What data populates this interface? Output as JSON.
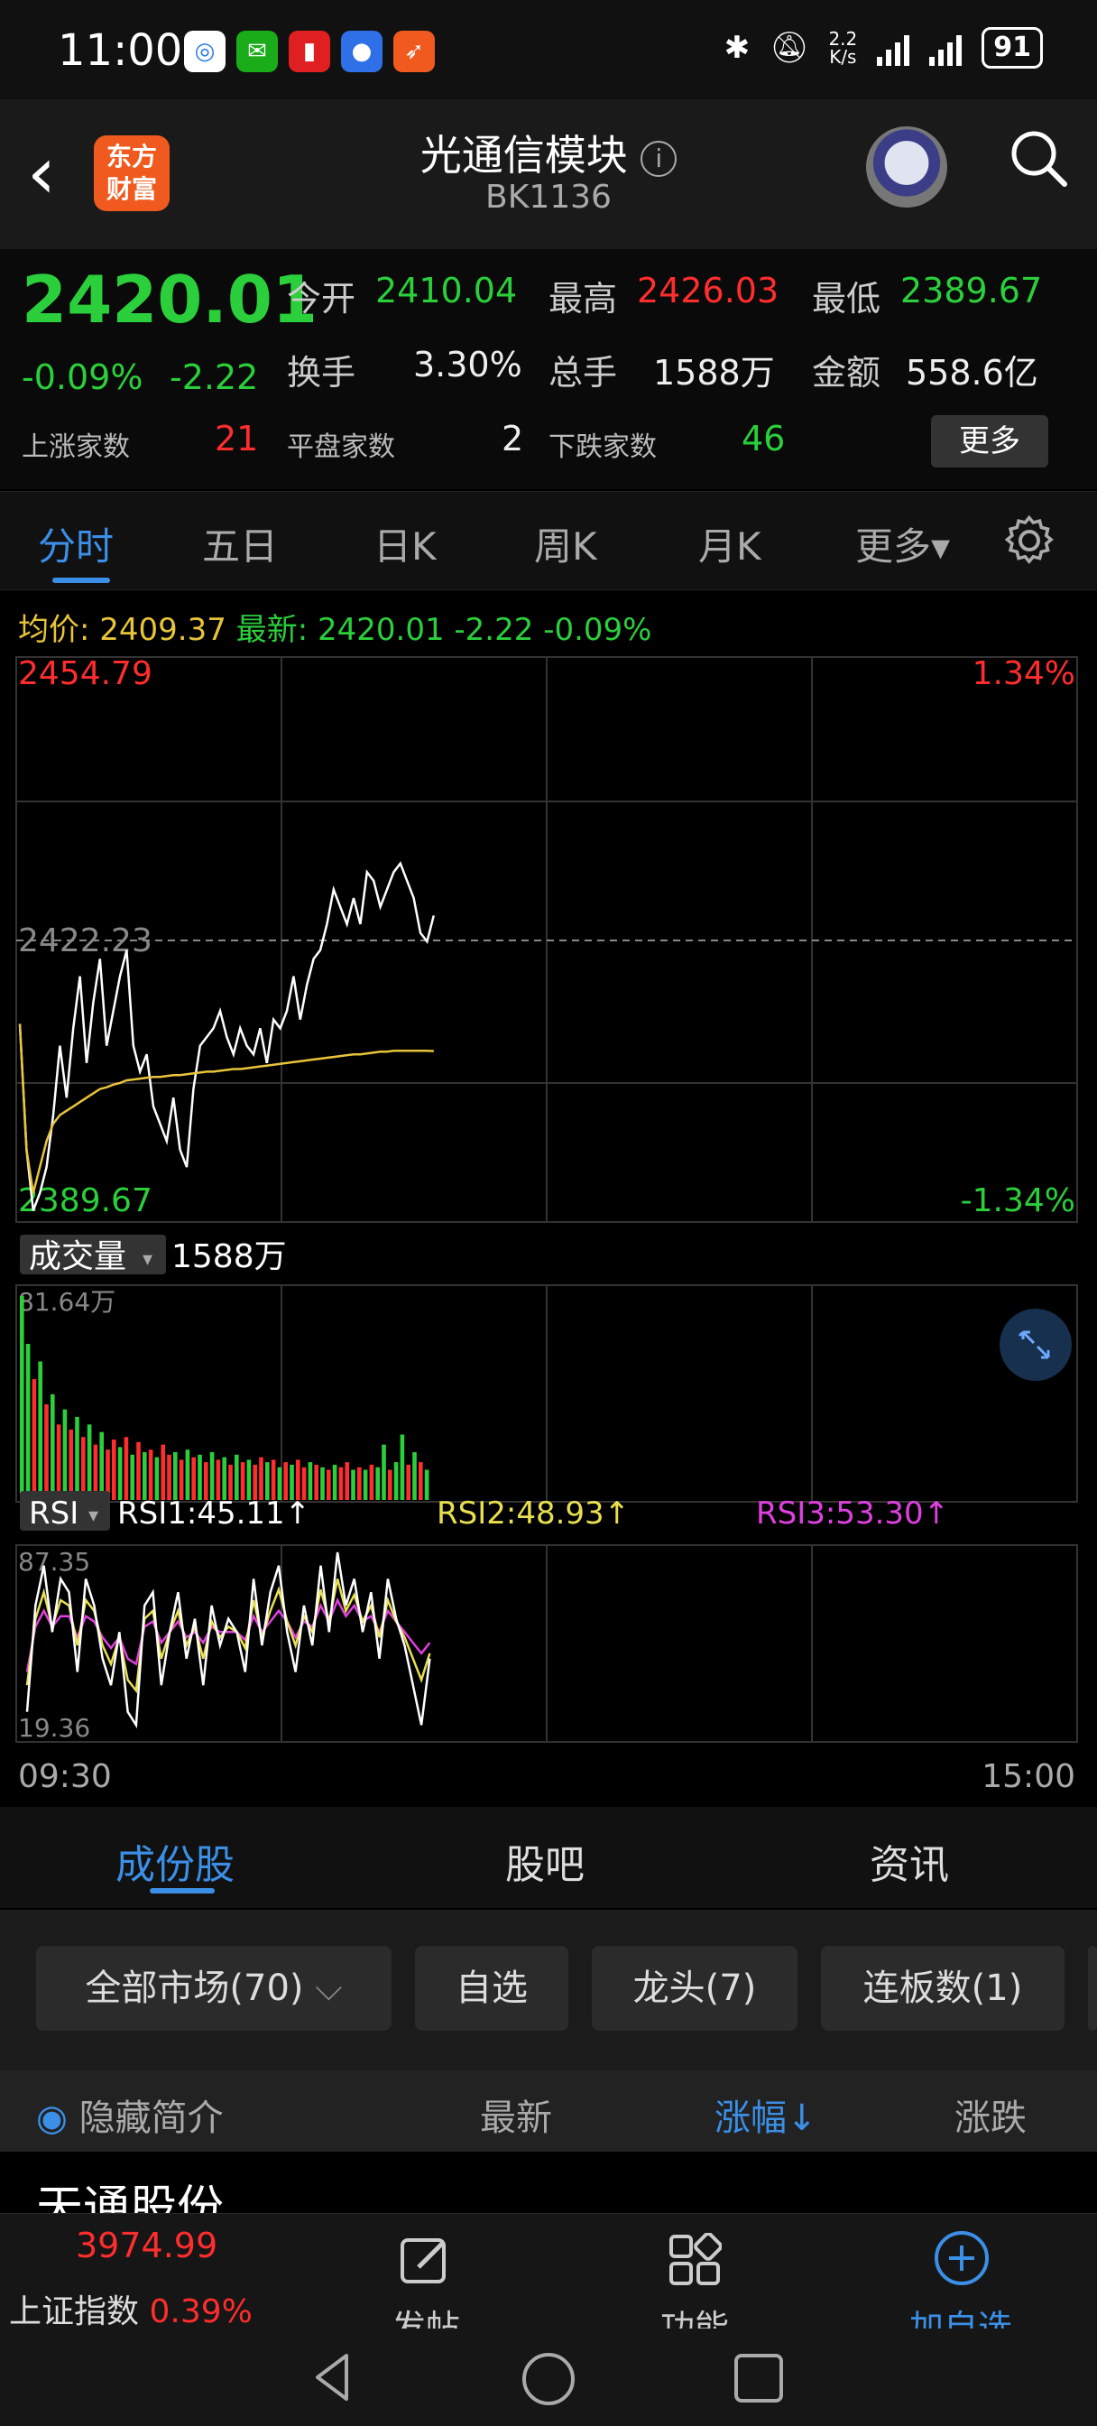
{
  "status_bar": {
    "time": "11:00",
    "net_speed_top": "2.2",
    "net_speed_unit": "K/s",
    "battery": "91"
  },
  "header": {
    "title": "光通信模块",
    "code": "BK1136",
    "logo_line1": "东方",
    "logo_line2": "财富"
  },
  "quote": {
    "price": "2420.01",
    "change_pct": "-0.09%",
    "change_val": "-2.22",
    "open_label": "今开",
    "open": "2410.04",
    "high_label": "最高",
    "high": "2426.03",
    "low_label": "最低",
    "low": "2389.67",
    "turnover_label": "换手",
    "turnover": "3.30%",
    "volume_label": "总手",
    "volume": "1588万",
    "amount_label": "金额",
    "amount": "558.6亿",
    "up_label": "上涨家数",
    "up_count": "21",
    "flat_label": "平盘家数",
    "flat_count": "2",
    "down_label": "下跌家数",
    "down_count": "46",
    "more": "更多"
  },
  "tabs": [
    "分时",
    "五日",
    "日K",
    "周K",
    "月K",
    "更多▾"
  ],
  "active_tab": "分时",
  "info_line": {
    "avg_label": "均价:",
    "avg": "2409.37",
    "latest_label": "最新:",
    "latest": "2420.01",
    "chg": "-2.22",
    "pct": "-0.09%"
  },
  "chart_data": {
    "type": "line",
    "price_axis": {
      "top": "2454.79",
      "mid": "2422.23",
      "bottom": "2389.67",
      "top_pct": "1.34%",
      "bottom_pct": "-1.34%"
    },
    "ylim": [
      2389.67,
      2454.79
    ],
    "prev_close": 2422.23,
    "x_labels": [
      "09:30",
      "15:00"
    ],
    "series": [
      {
        "values": [
          2412.5,
          2398,
          2391,
          2393,
          2396,
          2402,
          2410,
          2404,
          2412,
          2418,
          2408,
          2415,
          2420,
          2410,
          2414,
          2418,
          2421,
          2410,
          2407,
          2409,
          2403,
          2401,
          2399,
          2404,
          2398,
          2396,
          2405,
          2410,
          2411,
          2412,
          2414,
          2411,
          2409,
          2412,
          2410,
          2409,
          2412,
          2408,
          2413,
          2412,
          2414,
          2418,
          2413,
          2417,
          2420,
          2421,
          2424,
          2428,
          2426,
          2424,
          2427,
          2424,
          2430,
          2429,
          2426,
          2428,
          2430,
          2431,
          2429,
          2427,
          2423,
          2422,
          2425
        ]
      },
      {
        "values": [
          2412.5,
          2398,
          2393,
          2396,
          2399,
          2401,
          2402,
          2402.5,
          2403,
          2403.5,
          2404,
          2404.5,
          2405,
          2405.2,
          2405.5,
          2405.7,
          2406,
          2406.1,
          2406.2,
          2406.3,
          2406.4,
          2406.4,
          2406.5,
          2406.6,
          2406.6,
          2406.7,
          2406.8,
          2406.9,
          2407,
          2407,
          2407.1,
          2407.2,
          2407.3,
          2407.3,
          2407.4,
          2407.5,
          2407.6,
          2407.7,
          2407.8,
          2407.9,
          2408,
          2408.1,
          2408.2,
          2408.3,
          2408.4,
          2408.5,
          2408.6,
          2408.7,
          2408.8,
          2408.9,
          2409,
          2409,
          2409.1,
          2409.2,
          2409.3,
          2409.3,
          2409.4,
          2409.4,
          2409.4,
          2409.4,
          2409.4,
          2409.4,
          2409.37
        ]
      }
    ]
  },
  "volume_panel": {
    "label": "成交量",
    "total": "1588万",
    "max_label": "81.64万",
    "values": [
      81,
      62,
      48,
      55,
      38,
      42,
      30,
      36,
      28,
      33,
      25,
      30,
      22,
      27,
      20,
      24,
      21,
      25,
      18,
      23,
      19,
      20,
      17,
      22,
      18,
      19,
      16,
      20,
      17,
      18,
      15,
      19,
      16,
      17,
      14,
      18,
      15,
      16,
      14,
      17,
      15,
      16,
      13,
      15,
      14,
      16,
      13,
      15,
      14,
      13,
      12,
      14,
      13,
      15,
      12,
      13,
      12,
      14,
      13,
      22,
      12,
      15,
      26,
      14,
      19,
      15,
      12
    ],
    "colors": [
      "g",
      "g",
      "r",
      "g",
      "r",
      "g",
      "r",
      "g",
      "r",
      "g",
      "r",
      "g",
      "r",
      "g",
      "r",
      "r",
      "g",
      "r",
      "g",
      "r",
      "g",
      "r",
      "g",
      "r",
      "r",
      "g",
      "r",
      "g",
      "r",
      "g",
      "r",
      "g",
      "r",
      "g",
      "r",
      "g",
      "r",
      "g",
      "r",
      "r",
      "g",
      "r",
      "g",
      "r",
      "g",
      "r",
      "r",
      "g",
      "r",
      "g",
      "r",
      "g",
      "r",
      "r",
      "g",
      "r",
      "g",
      "r",
      "g",
      "g",
      "r",
      "g",
      "g",
      "r",
      "g",
      "r",
      "g"
    ]
  },
  "rsi": {
    "label": "RSI",
    "rsi1": "RSI1:45.11↑",
    "rsi2": "RSI2:48.93↑",
    "rsi3": "RSI3:53.30↑",
    "max_label": "87.35",
    "min_label": "19.36",
    "rsi1_values": [
      30,
      70,
      85,
      60,
      80,
      75,
      45,
      80,
      70,
      50,
      40,
      60,
      30,
      25,
      70,
      75,
      40,
      60,
      75,
      50,
      65,
      40,
      70,
      55,
      65,
      60,
      45,
      80,
      55,
      75,
      85,
      60,
      45,
      70,
      55,
      85,
      60,
      90,
      70,
      80,
      60,
      75,
      50,
      80,
      65,
      55,
      40,
      25,
      50
    ],
    "rsi2_values": [
      40,
      65,
      75,
      62,
      72,
      70,
      55,
      72,
      68,
      55,
      48,
      58,
      42,
      38,
      65,
      68,
      50,
      60,
      68,
      55,
      62,
      50,
      64,
      58,
      62,
      60,
      54,
      72,
      58,
      68,
      76,
      64,
      55,
      66,
      60,
      76,
      64,
      80,
      68,
      74,
      64,
      70,
      58,
      72,
      64,
      58,
      50,
      42,
      52
    ],
    "rsi3_values": [
      45,
      62,
      68,
      62,
      66,
      66,
      58,
      66,
      64,
      58,
      54,
      58,
      50,
      48,
      62,
      64,
      56,
      60,
      64,
      58,
      60,
      56,
      62,
      60,
      60,
      60,
      57,
      66,
      60,
      64,
      68,
      64,
      58,
      64,
      62,
      70,
      64,
      72,
      66,
      70,
      64,
      66,
      60,
      68,
      64,
      60,
      56,
      52,
      56
    ]
  },
  "subtabs": [
    "成份股",
    "股吧",
    "资讯"
  ],
  "filters": [
    "全部市场(70)",
    "自选",
    "龙头(7)",
    "连板数(1)"
  ],
  "columns": {
    "hide": "隐藏简介",
    "latest": "最新",
    "pct": "涨幅↓",
    "chg": "涨跌"
  },
  "row_peek": {
    "name": "天通股份"
  },
  "bottom_nav": {
    "index_value": "3974.99",
    "index_name": "上证指数",
    "index_pct": "0.39%",
    "post": "发帖",
    "func": "功能",
    "add": "加自选"
  },
  "colors": {
    "up": "#ff2d2d",
    "down": "#2bcf3b",
    "accent": "#3b8fe6",
    "avg": "#e8c43a",
    "rsi3": "#e040e0"
  }
}
